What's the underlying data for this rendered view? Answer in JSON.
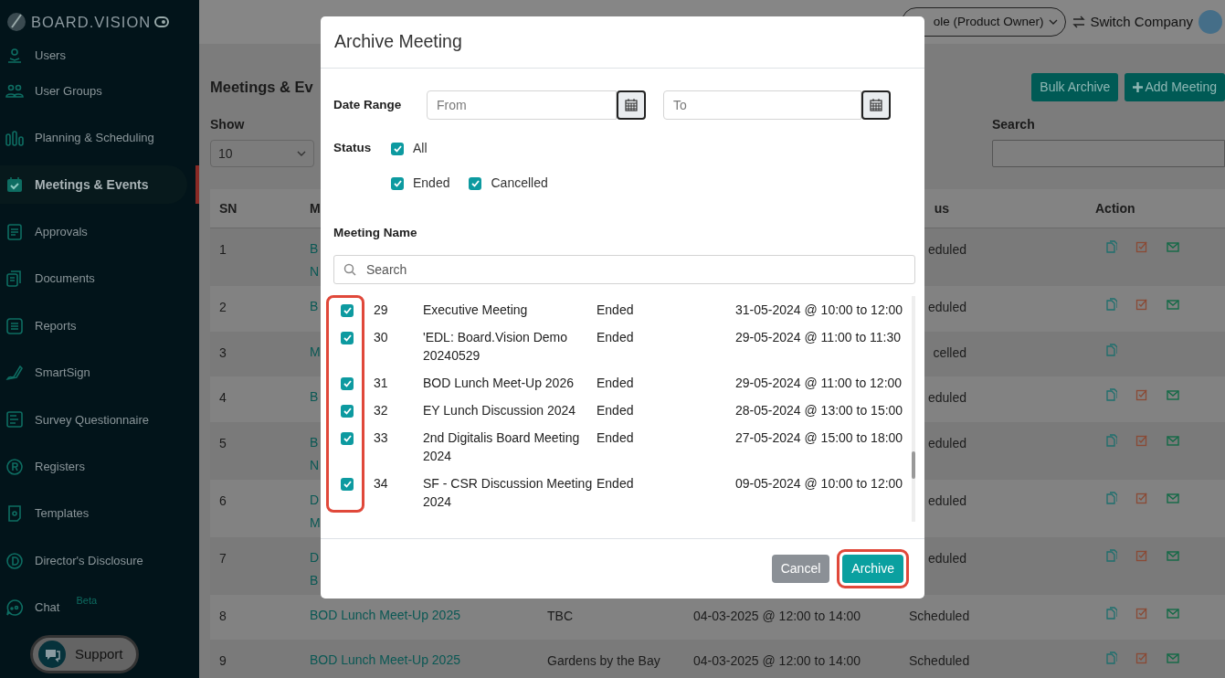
{
  "sidebar": {
    "logo": "BOARD.VISION",
    "items": [
      {
        "label": "Users",
        "selected": false
      },
      {
        "label": "User Groups",
        "selected": false
      },
      {
        "label": "Planning & Scheduling",
        "selected": false
      },
      {
        "label": "Meetings & Events",
        "selected": true
      },
      {
        "label": "Approvals",
        "selected": false
      },
      {
        "label": "Documents",
        "selected": false
      },
      {
        "label": "Reports",
        "selected": false
      },
      {
        "label": "SmartSign",
        "selected": false
      },
      {
        "label": "Survey Questionnaire",
        "selected": false
      },
      {
        "label": "Registers",
        "selected": false
      },
      {
        "label": "Templates",
        "selected": false
      },
      {
        "label": "Director's Disclosure",
        "selected": false
      },
      {
        "label": "Chat",
        "badge": "Beta",
        "selected": false
      }
    ],
    "support": "Support"
  },
  "topbar": {
    "role": "ole (Product Owner)",
    "switch": "Switch Company"
  },
  "page": {
    "title": "Meetings & Ev",
    "buttons": [
      {
        "label": "Bulk Archive",
        "kind": "plain"
      },
      {
        "label": "Add Meeting",
        "kind": "add"
      }
    ],
    "show_label": "Show",
    "show_value": "10",
    "search_label": "Search",
    "table": {
      "columns": [
        "SN",
        "M",
        "us",
        "Action"
      ],
      "rows": [
        {
          "sn": "1",
          "name_lines": [
            "B",
            "N"
          ],
          "status": "eduled",
          "actions": [
            {
              "kind": "copy"
            },
            {
              "kind": "edit"
            },
            {
              "kind": "mail"
            }
          ]
        },
        {
          "sn": "2",
          "name_lines": [
            "B"
          ],
          "status": "eduled",
          "actions": [
            {
              "kind": "copy"
            },
            {
              "kind": "edit"
            },
            {
              "kind": "mail"
            }
          ]
        },
        {
          "sn": "3",
          "name_lines": [
            "M"
          ],
          "status": "celled",
          "actions": [
            {
              "kind": "copy"
            }
          ]
        },
        {
          "sn": "4",
          "name_lines": [
            "B"
          ],
          "status": "eduled",
          "actions": [
            {
              "kind": "copy"
            },
            {
              "kind": "edit"
            },
            {
              "kind": "mail"
            }
          ]
        },
        {
          "sn": "5",
          "name_lines": [
            "B",
            "N"
          ],
          "status": "eduled",
          "actions": [
            {
              "kind": "copy"
            },
            {
              "kind": "edit"
            },
            {
              "kind": "mail"
            }
          ]
        },
        {
          "sn": "6",
          "name_lines": [
            "D",
            "M"
          ],
          "status": "eduled",
          "actions": [
            {
              "kind": "copy"
            },
            {
              "kind": "edit"
            },
            {
              "kind": "mail"
            }
          ]
        },
        {
          "sn": "7",
          "name_lines": [
            "D",
            "B"
          ],
          "status": "eduled",
          "actions": [
            {
              "kind": "copy"
            },
            {
              "kind": "edit"
            },
            {
              "kind": "mail"
            }
          ]
        },
        {
          "sn": "8",
          "name_lines": [
            "BOD Lunch Meet-Up 2025"
          ],
          "location": "TBC",
          "date": "04-03-2025 @ 12:00 to 14:00",
          "status": "Scheduled",
          "actions": [
            {
              "kind": "copy"
            },
            {
              "kind": "edit"
            },
            {
              "kind": "mail"
            }
          ]
        },
        {
          "sn": "9",
          "name_lines": [
            "BOD Lunch Meet-Up 2025"
          ],
          "location": "Gardens by the Bay",
          "date": "04-03-2025 @ 12:00 to 14:00",
          "status": "Scheduled",
          "actions": [
            {
              "kind": "copy"
            },
            {
              "kind": "edit"
            },
            {
              "kind": "mail"
            }
          ]
        }
      ]
    }
  },
  "modal": {
    "title": "Archive Meeting",
    "date_range_label": "Date Range",
    "from_placeholder": "From",
    "to_placeholder": "To",
    "status_label": "Status",
    "status_filters": [
      {
        "label": "All",
        "checked": true
      },
      {
        "label": "Ended",
        "checked": true
      },
      {
        "label": "Cancelled",
        "checked": true
      }
    ],
    "meeting_name_label": "Meeting Name",
    "search_placeholder": "Search",
    "highlight_checkboxes": true,
    "meetings": [
      {
        "checked": true,
        "number": "29",
        "name": "Executive Meeting",
        "status": "Ended",
        "date": "31-05-2024 @ 10:00 to 12:00"
      },
      {
        "checked": true,
        "number": "30",
        "name": "'EDL: Board.Vision Demo 20240529",
        "status": "Ended",
        "date": "29-05-2024 @ 11:00 to 11:30"
      },
      {
        "checked": true,
        "number": "31",
        "name": "BOD Lunch Meet-Up 2026",
        "status": "Ended",
        "date": "29-05-2024 @ 11:00 to 12:00"
      },
      {
        "checked": true,
        "number": "32",
        "name": "EY Lunch Discussion 2024",
        "status": "Ended",
        "date": "28-05-2024 @ 13:00 to 15:00"
      },
      {
        "checked": true,
        "number": "33",
        "name": "2nd Digitalis Board Meeting 2024",
        "status": "Ended",
        "date": "27-05-2024 @ 15:00 to 18:00"
      },
      {
        "checked": true,
        "number": "34",
        "name": "SF - CSR Discussion Meeting 2024",
        "status": "Ended",
        "date": "09-05-2024 @ 10:00 to 12:00"
      }
    ],
    "buttons": [
      {
        "label": "Cancel",
        "kind": "cancel",
        "highlighted": false
      },
      {
        "label": "Archive",
        "kind": "primary",
        "highlighted": true
      }
    ]
  }
}
